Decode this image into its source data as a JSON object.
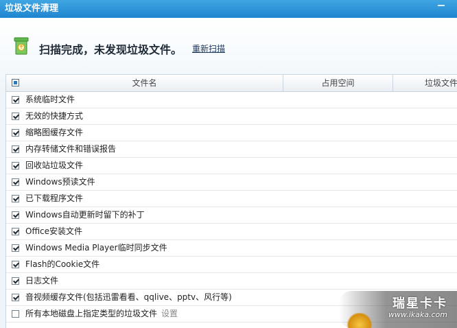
{
  "window": {
    "title": "垃圾文件清理"
  },
  "status": {
    "message": "扫描完成，未发现垃圾文件。",
    "rescan_label": "重新扫描"
  },
  "table": {
    "columns": [
      "文件名",
      "占用空间",
      "垃圾文件"
    ],
    "rows": [
      {
        "label": "系统临时文件",
        "checked": true
      },
      {
        "label": "无效的快捷方式",
        "checked": true
      },
      {
        "label": "缩略图缓存文件",
        "checked": true
      },
      {
        "label": "内存转储文件和错误报告",
        "checked": true
      },
      {
        "label": "回收站垃圾文件",
        "checked": true
      },
      {
        "label": "Windows预读文件",
        "checked": true
      },
      {
        "label": "已下载程序文件",
        "checked": true
      },
      {
        "label": "Windows自动更新时留下的补丁",
        "checked": true
      },
      {
        "label": "Office安装文件",
        "checked": true
      },
      {
        "label": "Windows Media Player临时同步文件",
        "checked": true
      },
      {
        "label": "Flash的Cookie文件",
        "checked": true
      },
      {
        "label": "日志文件",
        "checked": true
      },
      {
        "label": "音视频缓存文件(包括迅雷看看、qqlive、pptv、风行等)",
        "checked": true
      },
      {
        "label": "所有本地磁盘上指定类型的垃圾文件",
        "checked": false,
        "extra": "设置"
      }
    ]
  },
  "watermark": {
    "logo": "瑞星卡卡",
    "url": "www.ikaka.com"
  },
  "colors": {
    "titlebar": "#2a93d8",
    "header_check": "#2e78b8"
  },
  "icons": {
    "status": "recycle-bin-icon"
  }
}
